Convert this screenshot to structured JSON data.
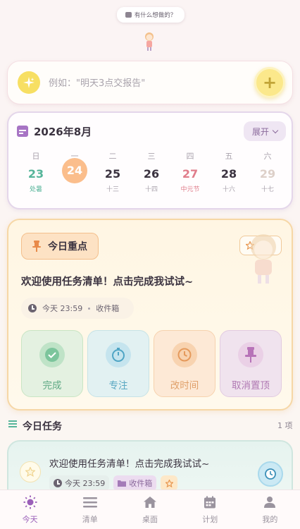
{
  "top_bubble": {
    "text": "有什么想做的？"
  },
  "quick_add": {
    "placeholder": "例如：\"明天3点交报告\"",
    "add_label": "+"
  },
  "calendar": {
    "month_label": "2026年8月",
    "expand_label": "展开",
    "days": [
      {
        "weekday": "日",
        "date": "23",
        "lunar": "处暑",
        "style": "green"
      },
      {
        "weekday": "一",
        "date": "24",
        "lunar": "",
        "style": "today"
      },
      {
        "weekday": "二",
        "date": "25",
        "lunar": "十三",
        "style": "normal"
      },
      {
        "weekday": "三",
        "date": "26",
        "lunar": "十四",
        "style": "normal"
      },
      {
        "weekday": "四",
        "date": "27",
        "lunar": "中元节",
        "style": "red"
      },
      {
        "weekday": "五",
        "date": "28",
        "lunar": "十六",
        "style": "normal"
      },
      {
        "weekday": "六",
        "date": "29",
        "lunar": "十七",
        "style": "faded"
      }
    ]
  },
  "focus": {
    "badge_label": "今日重点",
    "task_title": "欢迎使用任务清单！点击完成我试试~",
    "due": "今天 23:59",
    "list_name": "收件箱",
    "actions": [
      {
        "label": "完成",
        "icon": "check-icon"
      },
      {
        "label": "专注",
        "icon": "stopwatch-icon"
      },
      {
        "label": "改时间",
        "icon": "clock-icon"
      },
      {
        "label": "取消置顶",
        "icon": "pin-icon"
      }
    ]
  },
  "today_tasks": {
    "title": "今日任务",
    "count": "1 项",
    "items": [
      {
        "title": "欢迎使用任务清单！点击完成我试试~",
        "time": "今天 23:59",
        "list": "收件箱"
      }
    ]
  },
  "nav": {
    "items": [
      {
        "label": "今天",
        "icon": "sun-icon",
        "active": true
      },
      {
        "label": "清单",
        "icon": "list-icon",
        "active": false
      },
      {
        "label": "桌面",
        "icon": "home-icon",
        "active": false
      },
      {
        "label": "计划",
        "icon": "calendar-icon",
        "active": false
      },
      {
        "label": "我的",
        "icon": "user-icon",
        "active": false
      }
    ]
  },
  "colors": {
    "accent_purple": "#9a5fb8",
    "today_orange": "#fbbe8c",
    "focus_border": "#f6d7a6",
    "task_green": "#56b59a"
  }
}
